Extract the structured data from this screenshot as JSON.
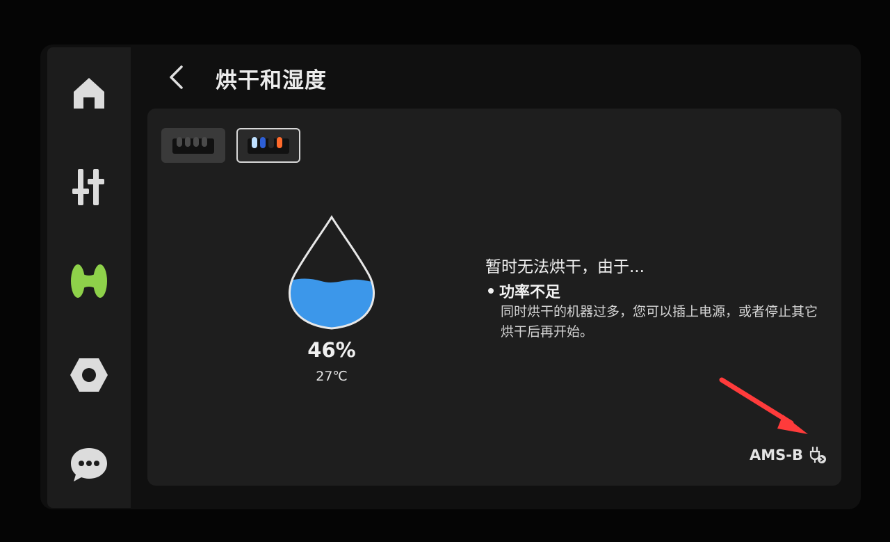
{
  "page": {
    "title": "烘干和湿度"
  },
  "sidebar": {
    "items": [
      {
        "name": "home",
        "icon": "home-icon",
        "active": false
      },
      {
        "name": "controls",
        "icon": "sliders-icon",
        "active": false
      },
      {
        "name": "filament",
        "icon": "spool-icon",
        "active": true
      },
      {
        "name": "settings",
        "icon": "hex-nut-icon",
        "active": false
      },
      {
        "name": "messages",
        "icon": "chat-bubble-icon",
        "active": false
      }
    ],
    "active_color": "#8ed14a"
  },
  "ams_tabs": [
    {
      "name": "ams-a",
      "active": false,
      "slot_colors": [
        "#1a1a1a",
        "#1a1a1a",
        "#1a1a1a",
        "#1a1a1a"
      ]
    },
    {
      "name": "ams-b",
      "active": true,
      "slot_colors": [
        "#bfe0ff",
        "#2d5fd6",
        "#111111",
        "#ff6a2b"
      ]
    }
  ],
  "humidity": {
    "value": "46%",
    "level": 0.46,
    "temperature": "27℃",
    "water_color": "#3c97ea"
  },
  "status": {
    "title": "暂时无法烘干，由于...",
    "reason_title": "功率不足",
    "reason_desc": "同时烘干的机器过多，您可以插上电源，或者停止其它烘干后再开始。"
  },
  "footer": {
    "unit_label": "AMS-B",
    "power_icon": "plug-icon"
  },
  "annotation": {
    "arrow_color": "#ff3b3b"
  }
}
